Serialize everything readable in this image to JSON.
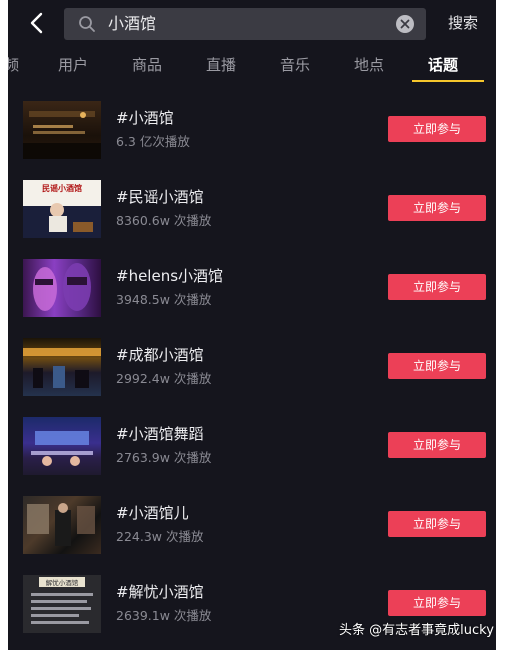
{
  "header": {
    "search_query": "小酒馆",
    "search_action_label": "搜索"
  },
  "tabs": [
    {
      "label": "频"
    },
    {
      "label": "用户"
    },
    {
      "label": "商品"
    },
    {
      "label": "直播"
    },
    {
      "label": "音乐"
    },
    {
      "label": "地点"
    },
    {
      "label": "话题"
    }
  ],
  "active_tab": "话题",
  "topics": [
    {
      "title": "#小酒馆",
      "plays": "6.3 亿次播放",
      "button": "立即参与"
    },
    {
      "title": "#民谣小酒馆",
      "plays": "8360.6w 次播放",
      "button": "立即参与",
      "thumb_caption": "民谣小酒馆"
    },
    {
      "title": "#helens小酒馆",
      "plays": "3948.5w 次播放",
      "button": "立即参与"
    },
    {
      "title": "#成都小酒馆",
      "plays": "2992.4w 次播放",
      "button": "立即参与"
    },
    {
      "title": "#小酒馆舞蹈",
      "plays": "2763.9w 次播放",
      "button": "立即参与"
    },
    {
      "title": "#小酒馆儿",
      "plays": "224.3w 次播放",
      "button": "立即参与"
    },
    {
      "title": "#解忧小酒馆",
      "plays": "2639.1w 次播放",
      "button": "立即参与",
      "thumb_caption": "解忧小酒馆"
    }
  ],
  "watermark": "头条 @有志者事竟成lucky",
  "colors": {
    "background": "#15151d",
    "button": "#ec4057",
    "tab_indicator": "#f6c62c"
  }
}
